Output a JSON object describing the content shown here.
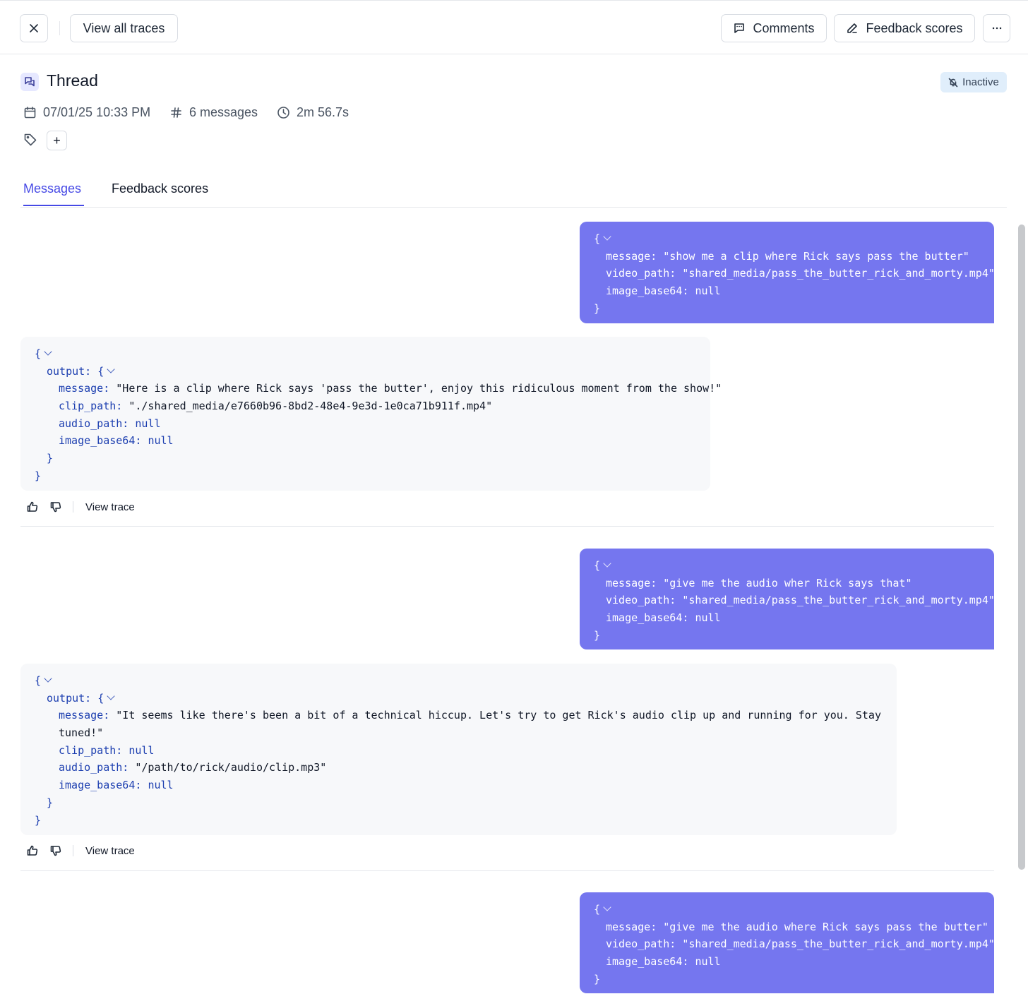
{
  "toolbar": {
    "close_label": "close",
    "view_all_traces": "View all traces",
    "comments": "Comments",
    "feedback_scores": "Feedback scores"
  },
  "thread": {
    "title": "Thread",
    "status": "Inactive",
    "date": "07/01/25 10:33 PM",
    "messages_count": "6 messages",
    "duration": "2m 56.7s",
    "add_tag": "+"
  },
  "tabs": [
    {
      "label": "Messages",
      "active": true
    },
    {
      "label": "Feedback scores",
      "active": false
    }
  ],
  "messages": [
    {
      "role": "user",
      "message": "\"show me a clip where Rick says pass the butter\"",
      "video_path": "\"shared_media/pass_the_butter_rick_and_morty.mp4\"",
      "image_base64": "null"
    },
    {
      "role": "assistant",
      "message": "\"Here is a clip where Rick says 'pass the butter', enjoy this ridiculous moment from the show!\"",
      "clip_path": "\"./shared_media/e7660b96-8bd2-48e4-9e3d-1e0ca71b911f.mp4\"",
      "audio_path": "null",
      "image_base64": "null",
      "view_trace": "View trace"
    },
    {
      "role": "user",
      "message": "\"give me the audio wher Rick says that\"",
      "video_path": "\"shared_media/pass_the_butter_rick_and_morty.mp4\"",
      "image_base64": "null"
    },
    {
      "role": "assistant",
      "message_line1": "\"It seems like there's been a bit of a technical hiccup. Let's try to get Rick's audio clip up and running for you. Stay",
      "message_line2": "tuned!\"",
      "clip_path": "null",
      "audio_path": "\"/path/to/rick/audio/clip.mp3\"",
      "image_base64": "null",
      "view_trace": "View trace"
    },
    {
      "role": "user",
      "message": "\"give me the audio where Rick says pass the butter\"",
      "video_path": "\"shared_media/pass_the_butter_rick_and_morty.mp4\"",
      "image_base64": "null"
    }
  ],
  "keys": {
    "open": "{",
    "close": "}",
    "message": "message: ",
    "video_path": "video_path: ",
    "image_base64": "image_base64: ",
    "output": "output: {",
    "clip_path": "clip_path: ",
    "audio_path": "audio_path: "
  },
  "colors": {
    "accent": "#4649e5",
    "user_bubble": "#7576ef",
    "assistant_bubble": "#f7f8fa",
    "json_key": "#1d3fb0",
    "status_badge_bg": "#e0eefb"
  }
}
